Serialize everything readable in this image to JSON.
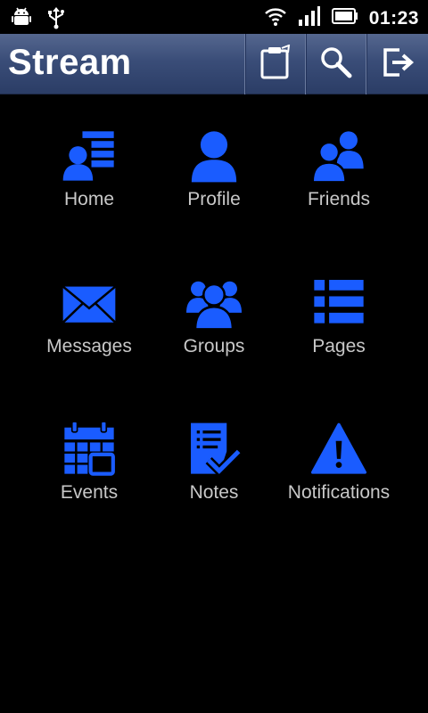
{
  "status_bar": {
    "icons": [
      "android-debug-icon",
      "usb-icon",
      "wifi-icon",
      "signal-icon",
      "battery-icon"
    ],
    "time": "01:23"
  },
  "action_bar": {
    "title": "Stream",
    "actions": [
      "compose-icon",
      "search-icon",
      "logout-icon"
    ]
  },
  "accent_color": "#1a5cff",
  "menu": {
    "items": [
      {
        "label": "Home",
        "icon": "home-feed-icon"
      },
      {
        "label": "Profile",
        "icon": "profile-icon"
      },
      {
        "label": "Friends",
        "icon": "friends-icon"
      },
      {
        "label": "Messages",
        "icon": "envelope-icon"
      },
      {
        "label": "Groups",
        "icon": "groups-icon"
      },
      {
        "label": "Pages",
        "icon": "pages-list-icon"
      },
      {
        "label": "Events",
        "icon": "calendar-icon"
      },
      {
        "label": "Notes",
        "icon": "notes-icon"
      },
      {
        "label": "Notifications",
        "icon": "warning-icon"
      }
    ]
  }
}
